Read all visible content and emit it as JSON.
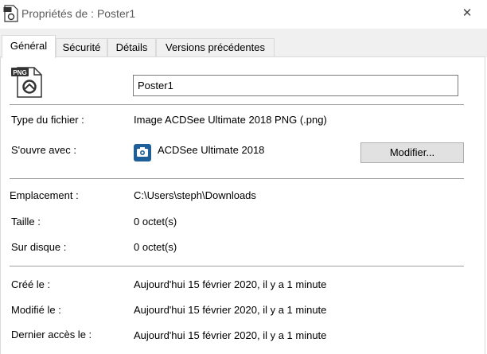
{
  "window": {
    "title": "Propriétés de : Poster1",
    "close_glyph": "✕",
    "title_icon": "png-file-icon"
  },
  "tabs": [
    {
      "label": "Général",
      "active": true
    },
    {
      "label": "Sécurité",
      "active": false
    },
    {
      "label": "Détails",
      "active": false
    },
    {
      "label": "Versions précédentes",
      "active": false
    }
  ],
  "general": {
    "file_icon": "png-file-icon",
    "file_icon_badge": "PNG",
    "file_name": "Poster1",
    "rows": {
      "type": {
        "label": "Type du fichier :",
        "value": "Image ACDSee Ultimate 2018 PNG (.png)"
      },
      "opens_with": {
        "label": "S'ouvre avec :",
        "value": "ACDSee Ultimate 2018",
        "button": "Modifier..."
      },
      "location": {
        "label": "Emplacement :",
        "value": "C:\\Users\\steph\\Downloads"
      },
      "size": {
        "label": "Taille :",
        "value": "0 octet(s)"
      },
      "size_on_disk": {
        "label": "Sur disque :",
        "value": "0 octet(s)"
      },
      "created": {
        "label": "Créé le :",
        "value": "Aujourd'hui 15 février 2020, il y a 1 minute"
      },
      "modified": {
        "label": "Modifié le :",
        "value": "Aujourd'hui 15 février 2020, il y a 1 minute"
      },
      "accessed": {
        "label": "Dernier accès le :",
        "value": "Aujourd'hui 15 février 2020, il y a 1 minute"
      }
    }
  },
  "colors": {
    "app_icon_bg": "#1f5f99",
    "tab_bg": "#f0f0f0",
    "separator": "#a0a0a0"
  }
}
